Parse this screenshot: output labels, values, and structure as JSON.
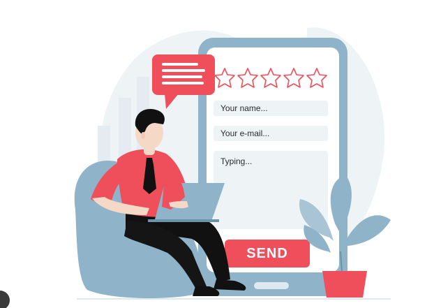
{
  "form": {
    "name_placeholder": "Your name...",
    "email_placeholder": "Your e-mail...",
    "message_placeholder": "Typing...",
    "send_label": "SEND"
  },
  "rating": {
    "stars_total": 5,
    "stars_filled": 0
  },
  "colors": {
    "accent": "#ee4f5a",
    "phone_frame": "#8fb3c8",
    "phone_screen": "#ffffff",
    "field": "#eef3f6",
    "beanbag": "#8fb3c8",
    "plant_pot": "#ee4f5a",
    "shirt": "#ee4f5a",
    "pants": "#111111",
    "skin": "#f6d8c6"
  },
  "icons": {
    "speech_bubble": "chat-bubble-icon",
    "star": "star-outline-icon"
  }
}
